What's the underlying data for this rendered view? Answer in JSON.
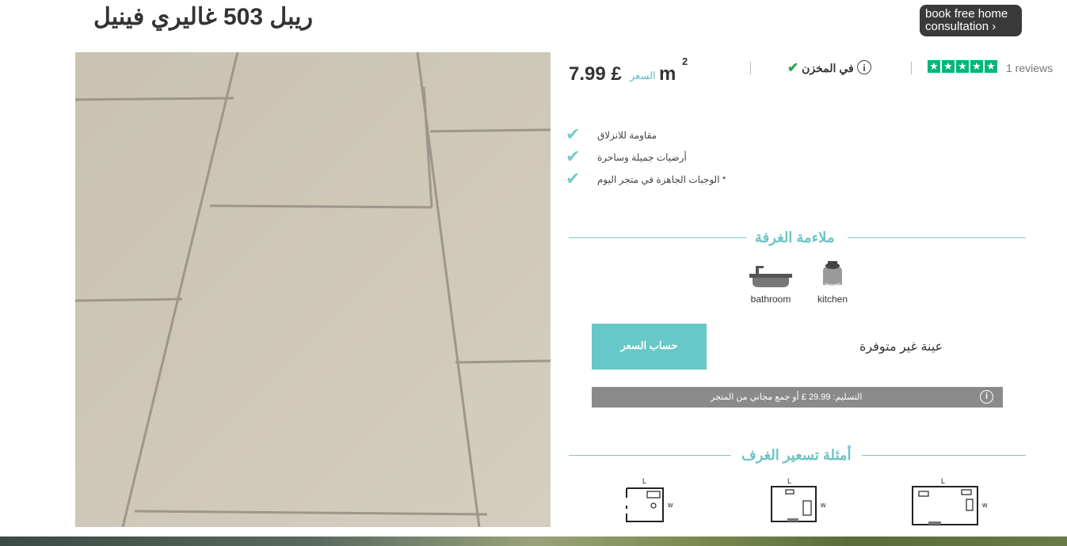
{
  "product": {
    "title": "ريبل 503 غاليري فينيل",
    "consult_button": "book free home consultation ›"
  },
  "pricing": {
    "price": "7.99 £",
    "price_label": "السعر",
    "unit": "m",
    "unit_superscript": "2",
    "stock_text": "في المخزن",
    "rating_stars": 5,
    "reviews_text": "1 reviews"
  },
  "features": [
    "مقاومة للانزلاق",
    "أرضيات جميلة وساحرة",
    "* الوجبات الجاهزة في متجر اليوم"
  ],
  "room_suitability": {
    "heading": "ملاءمة الغرفة",
    "rooms": [
      {
        "label": "bathroom",
        "icon": "bathtub-icon"
      },
      {
        "label": "kitchen",
        "icon": "kettle-icon"
      }
    ]
  },
  "actions": {
    "calc_button": "حساب السعر",
    "sample_text": "عينة غير متوفرة"
  },
  "delivery": {
    "text": "التسليم: 29.99 £ أو جمع مجاني من المتجر"
  },
  "room_examples": {
    "heading": "أمثلة تسعير الغرف",
    "plan_length_label": "L",
    "plan_width_label": "w"
  }
}
